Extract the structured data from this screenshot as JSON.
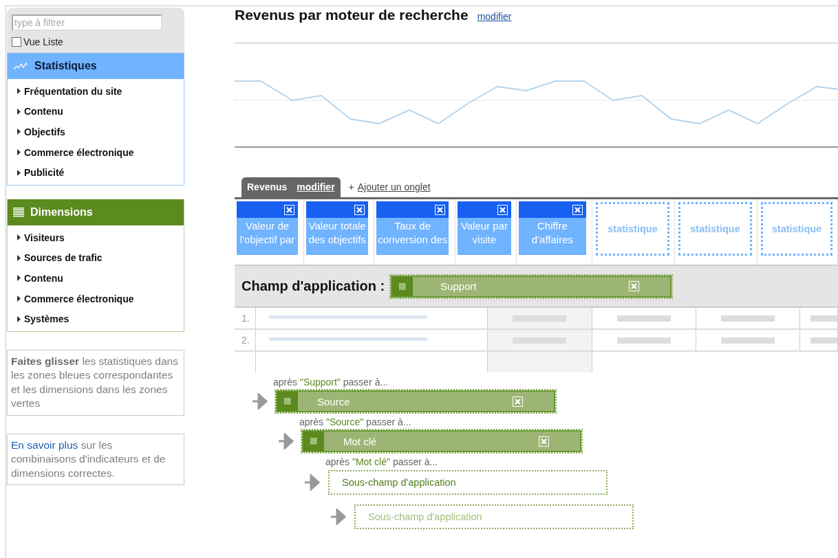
{
  "sidebar": {
    "filter": {
      "placeholder": "type à filtrer"
    },
    "list_view": {
      "label": "Vue Liste",
      "checked": false
    },
    "panels": [
      {
        "kind": "metrics",
        "title": "Statistiques",
        "items": [
          "Fréquentation du site",
          "Contenu",
          "Objectifs",
          "Commerce électronique",
          "Publicité"
        ]
      },
      {
        "kind": "dimensions",
        "title": "Dimensions",
        "items": [
          "Visiteurs",
          "Sources de trafic",
          "Contenu",
          "Commerce électronique",
          "Systèmes"
        ]
      }
    ],
    "help": [
      {
        "text": "**Faites glisser** les statistiques dans les zones bleues correspondantes et les dimensions dans les zones vertes"
      },
      {
        "link": "En savoir plus",
        "text": " sur les combinaisons d'indicateurs et de dimensions correctes."
      }
    ]
  },
  "report": {
    "title": "Revenus par moteur de recherche",
    "edit_link": "modifier",
    "tabs": [
      {
        "label": "Revenus",
        "edit_link": "modifier",
        "selected": true
      }
    ],
    "add_tab": {
      "icon": "+",
      "label": "Ajouter un onglet"
    },
    "metrics": [
      {
        "kind": "metric",
        "label": "Valeur de l'objectif par"
      },
      {
        "kind": "metric",
        "label": "Valeur totale des objectifs"
      },
      {
        "kind": "metric",
        "label": "Taux de conversion des"
      },
      {
        "kind": "metric",
        "label": "Valeur par visite"
      },
      {
        "kind": "metric",
        "label": "Chiffre d'affaires"
      },
      {
        "kind": "slot",
        "label": "statistique"
      },
      {
        "kind": "slot",
        "label": "statistique"
      },
      {
        "kind": "slot",
        "label": "statistique"
      }
    ],
    "scope": {
      "label": "Champ d'application :",
      "dimension": "Support"
    },
    "table": {
      "rows": [
        {
          "number": "1."
        },
        {
          "number": "2."
        }
      ]
    },
    "drilldown": {
      "caption": {
        "before": "après ",
        "value": "\"Support\"",
        "after": " passer à..."
      },
      "kind": "dimension",
      "label": "Source",
      "children": [
        {
          "caption": {
            "before": "après ",
            "value": "\"Source\"",
            "after": " passer à..."
          },
          "kind": "dimension",
          "label": "Mot clé",
          "children": [
            {
              "caption": {
                "before": "après ",
                "value": "\"Mot clé\"",
                "after": " passer à..."
              },
              "kind": "slot",
              "label": "Sous-champ d'application",
              "disabled": false,
              "children": [
                {
                  "kind": "slot",
                  "label": "Sous-champ d'application",
                  "disabled": true
                }
              ]
            }
          ]
        }
      ]
    }
  }
}
